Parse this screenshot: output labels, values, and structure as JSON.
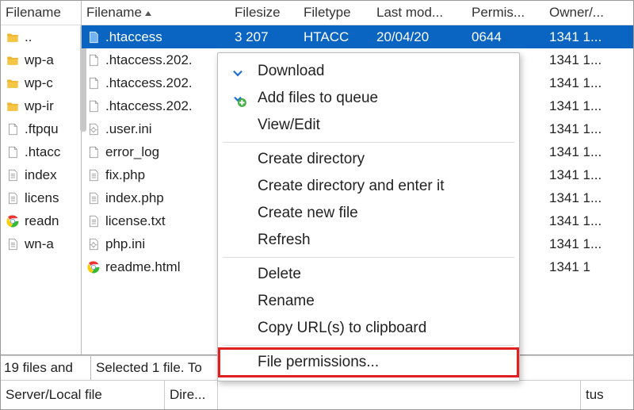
{
  "left": {
    "header": "Filename",
    "items": [
      {
        "icon": "folder",
        "name": ".."
      },
      {
        "icon": "folder",
        "name": "wp-a"
      },
      {
        "icon": "folder",
        "name": "wp-c"
      },
      {
        "icon": "folder",
        "name": "wp-ir"
      },
      {
        "icon": "file",
        "name": ".ftpqu"
      },
      {
        "icon": "file",
        "name": ".htacc"
      },
      {
        "icon": "doc",
        "name": "index"
      },
      {
        "icon": "doc",
        "name": "licens"
      },
      {
        "icon": "chrome",
        "name": "readn"
      },
      {
        "icon": "doc",
        "name": "wn-a"
      }
    ]
  },
  "right": {
    "headers": {
      "name": "Filename",
      "size": "Filesize",
      "type": "Filetype",
      "mod": "Last mod...",
      "perm": "Permis...",
      "own": "Owner/..."
    },
    "rows": [
      {
        "icon": "file-sel",
        "name": ".htaccess",
        "size": "3 207",
        "type": "HTACC",
        "mod": "20/04/20",
        "perm": "0644",
        "own": "1341 1...",
        "selected": true
      },
      {
        "icon": "file",
        "name": ".htaccess.202.",
        "size": "",
        "type": "",
        "mod": "",
        "perm": "",
        "own": "1341 1..."
      },
      {
        "icon": "file",
        "name": ".htaccess.202.",
        "size": "",
        "type": "",
        "mod": "",
        "perm": "",
        "own": "1341 1..."
      },
      {
        "icon": "file",
        "name": ".htaccess.202.",
        "size": "",
        "type": "",
        "mod": "",
        "perm": "",
        "own": "1341 1..."
      },
      {
        "icon": "ini",
        "name": ".user.ini",
        "size": "",
        "type": "",
        "mod": "",
        "perm": "",
        "own": "1341 1..."
      },
      {
        "icon": "file",
        "name": "error_log",
        "size": "",
        "type": "",
        "mod": "",
        "perm": "",
        "own": "1341 1..."
      },
      {
        "icon": "doc",
        "name": "fix.php",
        "size": "",
        "type": "",
        "mod": "",
        "perm": "",
        "own": "1341 1..."
      },
      {
        "icon": "doc",
        "name": "index.php",
        "size": "",
        "type": "",
        "mod": "",
        "perm": "",
        "own": "1341 1..."
      },
      {
        "icon": "doc",
        "name": "license.txt",
        "size": "",
        "type": "",
        "mod": "",
        "perm": "",
        "own": "1341 1..."
      },
      {
        "icon": "ini",
        "name": "php.ini",
        "size": "",
        "type": "",
        "mod": "",
        "perm": "",
        "own": "1341 1..."
      },
      {
        "icon": "chrome",
        "name": "readme.html",
        "size": "",
        "type": "",
        "mod": "",
        "perm": "",
        "own": "1341 1"
      }
    ]
  },
  "status": {
    "left": "19 files and",
    "right": "Selected 1 file. To"
  },
  "queue": {
    "col1": "Server/Local file",
    "col2": "Dire...",
    "col4": "tus"
  },
  "ctx": {
    "download": "Download",
    "add_queue": "Add files to queue",
    "view_edit": "View/Edit",
    "create_dir": "Create directory",
    "create_dir_enter": "Create directory and enter it",
    "create_file": "Create new file",
    "refresh": "Refresh",
    "delete": "Delete",
    "rename": "Rename",
    "copy_url": "Copy URL(s) to clipboard",
    "file_perm": "File permissions..."
  }
}
